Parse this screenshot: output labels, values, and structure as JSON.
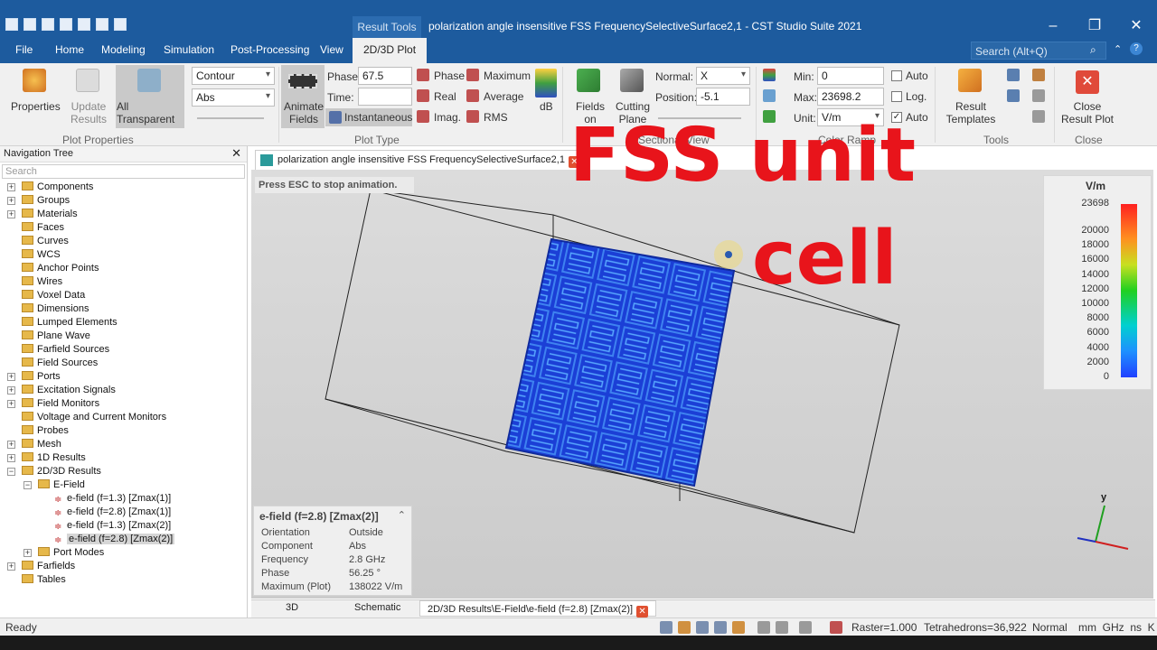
{
  "window": {
    "context_tab": "Result Tools",
    "title": "polarization angle insensitive FSS FrequencySelectiveSurface2,1 - CST Studio Suite 2021"
  },
  "menu_tabs": [
    "File",
    "Home",
    "Modeling",
    "Simulation",
    "Post-Processing",
    "View",
    "2D/3D Plot"
  ],
  "search_placeholder": "Search (Alt+Q)",
  "ribbon": {
    "properties": "Properties",
    "update_results": "Update Results",
    "all_transparent": "All Transparent",
    "plot_properties_group": "Plot Properties",
    "plot_style": "Contour",
    "plot_component": "Abs",
    "animate_fields": "Animate Fields",
    "phase_label": "Phase:",
    "phase_value": "67.5",
    "time_label": "Time:",
    "time_value": "",
    "instantaneous": "Instantaneous",
    "phase_btn": "Phase",
    "real_btn": "Real",
    "imag_btn": "Imag.",
    "maximum_btn": "Maximum",
    "average_btn": "Average",
    "rms_btn": "RMS",
    "db_btn": "dB",
    "plot_type_group": "Plot Type",
    "fields_on_plane": "Fields on Plane",
    "cutting_plane": "Cutting Plane",
    "normal_label": "Normal:",
    "normal_value": "X",
    "position_label": "Position:",
    "position_value": "-5.1",
    "sectional_group": "Sectional View",
    "min_label": "Min:",
    "min_value": "0",
    "max_label": "Max:",
    "max_value": "23698.2",
    "unit_label": "Unit:",
    "unit_value": "V/m",
    "auto_label": "Auto",
    "log_label": "Log.",
    "auto2_label": "Auto",
    "color_ramp_group": "Color Ramp",
    "result_templates": "Result Templates",
    "tools_group": "Tools",
    "close_result_plot": "Close Result Plot",
    "close_group": "Close"
  },
  "nav": {
    "title": "Navigation Tree",
    "search": "Search",
    "items": [
      "Components",
      "Groups",
      "Materials",
      "Faces",
      "Curves",
      "WCS",
      "Anchor Points",
      "Wires",
      "Voxel Data",
      "Dimensions",
      "Lumped Elements",
      "Plane Wave",
      "Farfield Sources",
      "Field Sources",
      "Ports",
      "Excitation Signals",
      "Field Monitors",
      "Voltage and Current Monitors",
      "Probes",
      "Mesh",
      "1D Results",
      "2D/3D Results",
      "E-Field",
      "e-field (f=1.3) [Zmax(1)]",
      "e-field (f=2.8) [Zmax(1)]",
      "e-field (f=1.3) [Zmax(2)]",
      "e-field (f=2.8) [Zmax(2)]",
      "Port Modes",
      "Farfields",
      "Tables"
    ]
  },
  "view": {
    "doc_tab": "polarization angle insensitive FSS FrequencySelectiveSurface2,1",
    "esc_hint": "Press ESC to stop animation.",
    "overlay_line1": "FSS unit",
    "overlay_line2": "cell",
    "legend_unit": "V/m",
    "legend_ticks": [
      "23698",
      "20000",
      "18000",
      "16000",
      "14000",
      "12000",
      "10000",
      "8000",
      "6000",
      "4000",
      "2000",
      "0"
    ],
    "axis_y": "y"
  },
  "info": {
    "title": "e-field (f=2.8) [Zmax(2)]",
    "rows": [
      {
        "k": "Orientation",
        "v": "Outside"
      },
      {
        "k": "Component",
        "v": "Abs"
      },
      {
        "k": "Frequency",
        "v": "2.8 GHz"
      },
      {
        "k": "Phase",
        "v": "56.25 °"
      },
      {
        "k": "Maximum (Plot)",
        "v": "138022 V/m"
      }
    ]
  },
  "bottom_tabs": [
    "3D",
    "Schematic",
    "2D/3D Results\\E-Field\\e-field (f=2.8) [Zmax(2)]"
  ],
  "status": {
    "ready": "Ready",
    "raster": "Raster=1.000",
    "tets": "Tetrahedrons=36,922",
    "mode": "Normal",
    "units": "mm  GHz  ns  K"
  },
  "colors": {
    "brand": "#1d5b9e",
    "overlay": "#e8141b",
    "field_blue": "#1b3fd6"
  }
}
